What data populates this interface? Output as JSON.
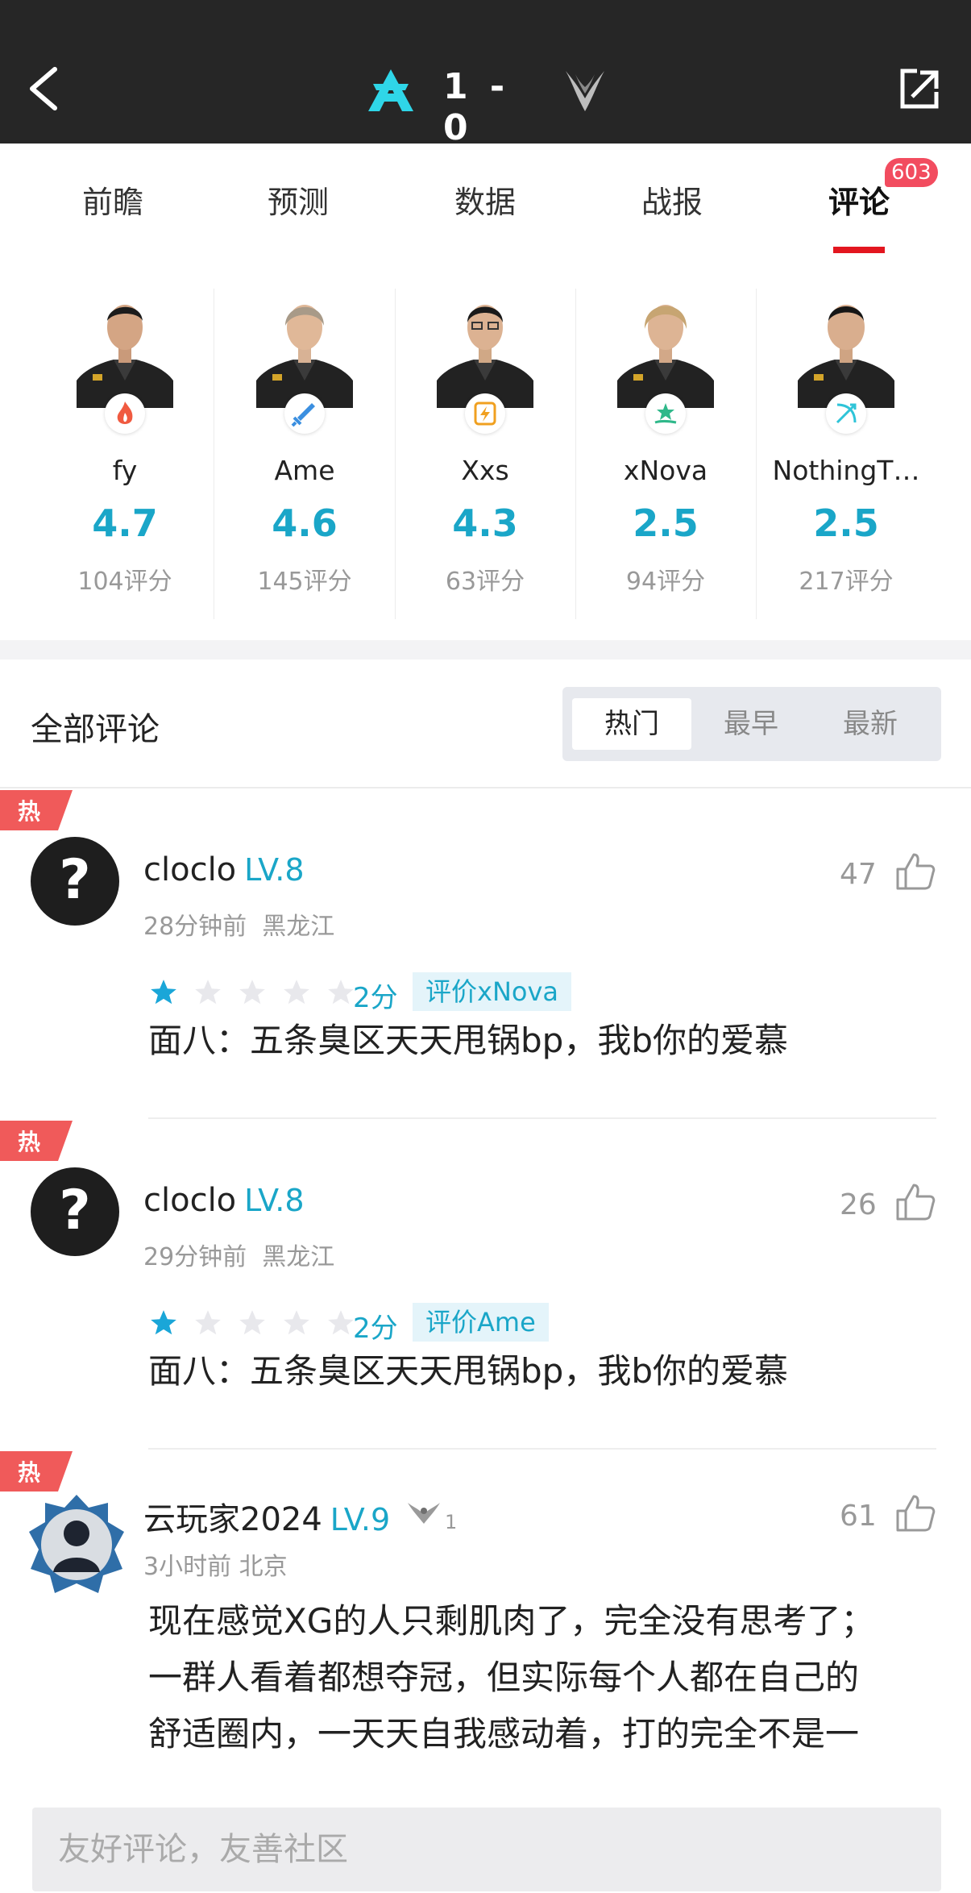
{
  "header": {
    "score": "1 - 0",
    "team_a_icon": "team-a-logo",
    "team_b_icon": "team-b-logo",
    "accent": "#2fd6e8"
  },
  "tabs": [
    {
      "label": "前瞻"
    },
    {
      "label": "预测"
    },
    {
      "label": "数据"
    },
    {
      "label": "战报"
    },
    {
      "label": "评论",
      "badge": "603",
      "active": true
    }
  ],
  "players": [
    {
      "name": "fy",
      "rating": "4.7",
      "count": "104评分",
      "role_icon": "fire-icon",
      "role_color": "#f05a40"
    },
    {
      "name": "Ame",
      "rating": "4.6",
      "count": "145评分",
      "role_icon": "sword-icon",
      "role_color": "#3b8fe0"
    },
    {
      "name": "Xxs",
      "rating": "4.3",
      "count": "63评分",
      "role_icon": "lightning-shield-icon",
      "role_color": "#f0a020"
    },
    {
      "name": "xNova",
      "rating": "2.5",
      "count": "94评分",
      "role_icon": "healing-hand-icon",
      "role_color": "#2fb88a"
    },
    {
      "name": "NothingT…",
      "rating": "2.5",
      "count": "217评分",
      "role_icon": "bow-icon",
      "role_color": "#2fc4d8"
    }
  ],
  "comments_section": {
    "title": "全部评论",
    "sort_options": [
      "热门",
      "最早",
      "最新"
    ],
    "active_sort": "热门"
  },
  "comments": [
    {
      "hot": "热",
      "user": "cloclo",
      "level": "LV.8",
      "time": "28分钟前",
      "location": "黑龙江",
      "likes": "47",
      "stars": 1,
      "score": "2分",
      "rated_player": "评价xNova",
      "text": "面八：五条臭区天天甩锅bp，我b你的爱慕"
    },
    {
      "hot": "热",
      "user": "cloclo",
      "level": "LV.8",
      "time": "29分钟前",
      "location": "黑龙江",
      "likes": "26",
      "stars": 1,
      "score": "2分",
      "rated_player": "评价Ame",
      "text": "面八：五条臭区天天甩锅bp，我b你的爱慕"
    },
    {
      "hot": "热",
      "user": "云玩家2024",
      "level": "LV.9",
      "badge_count": "1",
      "time": "3小时前",
      "location": "北京",
      "likes": "61",
      "text_lines": [
        "现在感觉XG的人只剩肌肉了，完全没有思考了；",
        "一群人看着都想夺冠，但实际每个人都在自己的",
        "舒适圈内，一天天自我感动着，打的完全不是一"
      ]
    }
  ],
  "input": {
    "placeholder": "友好评论，友善社区"
  }
}
